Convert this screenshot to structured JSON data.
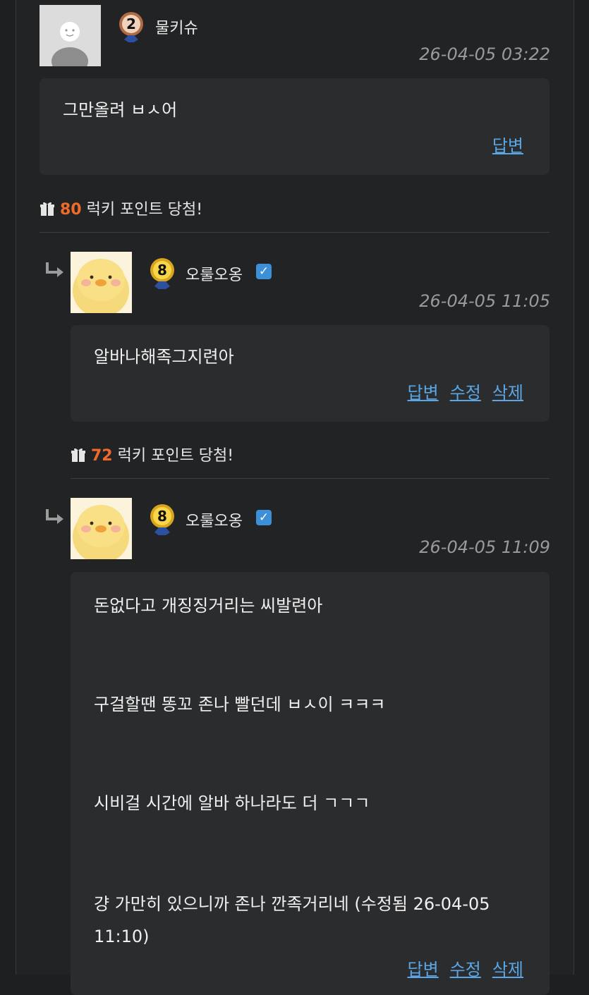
{
  "comments": [
    {
      "username": "물키슈",
      "level": "2",
      "timestamp": "26-04-05 03:22",
      "body": "그만올려 ㅂㅅ어",
      "actions": [
        "답변"
      ],
      "lucky": {
        "icon": "gift-icon",
        "points": "80",
        "text": "럭키 포인트 당첨!"
      }
    },
    {
      "username": "오룰오옹",
      "level": "8",
      "verified": true,
      "timestamp": "26-04-05 11:05",
      "body": "알바나해족그지련아",
      "actions": [
        "답변",
        "수정",
        "삭제"
      ],
      "lucky": {
        "icon": "gift-icon",
        "points": "72",
        "text": "럭키 포인트 당첨!"
      }
    },
    {
      "username": "오룰오옹",
      "level": "8",
      "verified": true,
      "timestamp": "26-04-05 11:09",
      "paragraphs": [
        "돈없다고 개징징거리는 씨발련아",
        "구걸할땐 똥꼬 존나 빨던데 ㅂㅅ이 ㅋㅋㅋ",
        "시비걸 시간에 알바 하나라도 더 ㄱㄱㄱ",
        "걍 가만히 있으니까 존나 깐족거리네 (수정됨 26-04-05 11:10)"
      ],
      "actions": [
        "답변",
        "수정",
        "삭제"
      ]
    }
  ],
  "colors": {
    "accent_link": "#5aa6e6",
    "points": "#f06a2a",
    "verified": "#3d8fd8"
  }
}
